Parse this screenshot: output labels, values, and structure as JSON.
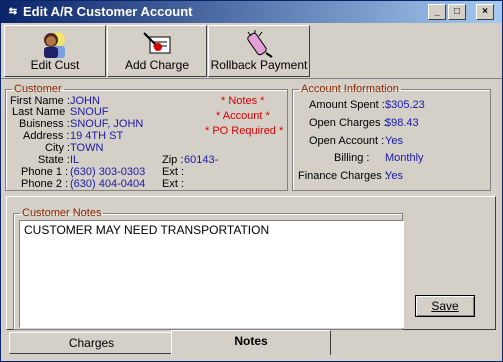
{
  "window": {
    "title": "Edit A/R Customer Account",
    "controls": [
      "_",
      "□",
      "×"
    ]
  },
  "toolbar": {
    "edit_cust": "Edit Cust",
    "add_charge": "Add Charge",
    "rollback_payment": "Rollback Payment"
  },
  "customer": {
    "group_label": "Customer",
    "labels": {
      "first_name": "First Name :",
      "last_name": "Last Name",
      "business": "Buisness :",
      "address": "Address :",
      "city": "City :",
      "state": "State :",
      "zip": "Zip :",
      "phone1": "Phone 1 :",
      "phone2": "Phone 2 :",
      "ext1": "Ext :",
      "ext2": "Ext :"
    },
    "values": {
      "first_name": "JOHN",
      "last_name": "SNOUF",
      "business": "SNOUF, JOHN",
      "address": "19 4TH ST",
      "city": "TOWN",
      "state": "IL",
      "zip": "60143-",
      "phone1": "(630) 303-0303",
      "phone2": "(630) 404-0404"
    },
    "flags": [
      "* Notes *",
      "* Account *",
      "* PO Required *"
    ]
  },
  "account": {
    "group_label": "Account Information",
    "rows": [
      {
        "label": "Amount Spent :",
        "value": "$305.23"
      },
      {
        "label": "Open Charges :",
        "value": "$98.43"
      },
      {
        "label": "Open Account :",
        "value": "Yes"
      },
      {
        "label": "Billing :",
        "value": "Monthly"
      },
      {
        "label": "Finance Charges :",
        "value": "Yes"
      }
    ]
  },
  "notes": {
    "group_label": "Customer Notes",
    "text": "CUSTOMER MAY NEED TRANSPORTATION",
    "save_label": "Save"
  },
  "tabs": [
    {
      "label": "Charges",
      "active": false
    },
    {
      "label": "Notes",
      "active": true
    }
  ]
}
